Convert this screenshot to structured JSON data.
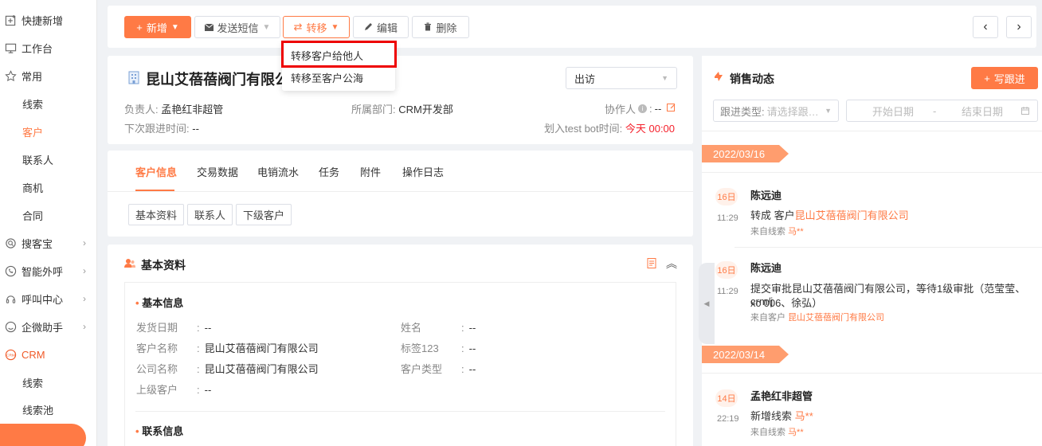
{
  "sidebar": {
    "items": [
      {
        "label": "快捷新增",
        "icon": "plus-square-icon"
      },
      {
        "label": "工作台",
        "icon": "monitor-icon"
      },
      {
        "label": "常用",
        "icon": "star-icon"
      },
      {
        "label": "线索"
      },
      {
        "label": "客户"
      },
      {
        "label": "联系人"
      },
      {
        "label": "商机"
      },
      {
        "label": "合同"
      },
      {
        "label": "搜客宝",
        "icon": "search-globe-icon"
      },
      {
        "label": "智能外呼",
        "icon": "phone-icon"
      },
      {
        "label": "呼叫中心",
        "icon": "headset-icon"
      },
      {
        "label": "企微助手",
        "icon": "wechat-icon"
      },
      {
        "label": "CRM",
        "icon": "crm-icon"
      },
      {
        "label": "线索"
      },
      {
        "label": "线索池"
      }
    ],
    "active_color": "#ff7a45"
  },
  "toolbar": {
    "new_label": "新增",
    "sms_label": "发送短信",
    "transfer_label": "转移",
    "edit_label": "编辑",
    "delete_label": "删除"
  },
  "dropdown": {
    "items": [
      "转移客户给他人",
      "转移至客户公海"
    ]
  },
  "customer": {
    "title": "昆山艾蓓蓓阀门有限公",
    "owner_label": "负责人:",
    "owner_value": "孟艳红非超管",
    "dept_label": "所属部门:",
    "dept_value": "CRM开发部",
    "collab_label": "协作人",
    "collab_value": "--",
    "next_follow_label": "下次跟进时间:",
    "next_follow_value": "--",
    "assign_label": "划入test bot时间:",
    "assign_value": "今天 00:00",
    "visit_select": "出访"
  },
  "tabs": [
    "客户信息",
    "交易数据",
    "电销流水",
    "任务",
    "附件",
    "操作日志"
  ],
  "subtabs": [
    "基本资料",
    "联系人",
    "下级客户"
  ],
  "basic": {
    "title": "基本资料",
    "section_info": "基本信息",
    "section_contact": "联系信息",
    "fields_left": [
      {
        "label": "发货日期",
        "value": "--"
      },
      {
        "label": "客户名称",
        "value": "昆山艾蓓蓓阀门有限公司"
      },
      {
        "label": "公司名称",
        "value": "昆山艾蓓蓓阀门有限公司"
      },
      {
        "label": "上级客户",
        "value": "--"
      }
    ],
    "fields_right": [
      {
        "label": "姓名",
        "value": "--"
      },
      {
        "label": "标签123",
        "value": "--"
      },
      {
        "label": "客户类型",
        "value": "--"
      }
    ]
  },
  "sales": {
    "title": "销售动态",
    "write_label": "写跟进",
    "filter_label": "跟进类型:",
    "filter_placeholder": "请选择跟…",
    "start_placeholder": "开始日期",
    "date_sep": "-",
    "end_placeholder": "结束日期",
    "groups": [
      {
        "date": "2022/03/16"
      },
      {
        "date": "2022/03/14"
      }
    ],
    "activities": [
      {
        "day": "16日",
        "time": "11:29",
        "name": "陈远迪",
        "text_prefix": "转成 客户",
        "text_link": "昆山艾蓓蓓阀门有限公司",
        "src_prefix": "来自线索",
        "src_link": "马**"
      },
      {
        "day": "16日",
        "time": "11:29",
        "name": "陈远迪",
        "text_line1": "提交审批昆山艾蓓蓓阀门有限公司，等待1级审批（范莹莹、crm/j",
        "text_line2": "xc 006、徐弘）",
        "src_prefix": "来自客户",
        "src_link": "昆山艾蓓蓓阀门有限公司"
      },
      {
        "day": "14日",
        "time": "22:19",
        "name": "孟艳红非超管",
        "text_prefix": "新增线索",
        "text_link": "马**",
        "src_prefix": "来自线索",
        "src_link": "马**"
      }
    ]
  }
}
